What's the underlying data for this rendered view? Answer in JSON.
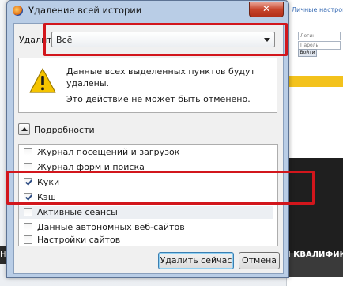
{
  "dialog": {
    "title": "Удаление всей истории",
    "close_glyph": "✕",
    "period_label": "Удалить:",
    "period_value": "Всё",
    "warning_line1": "Данные всех выделенных пунктов будут удалены.",
    "warning_line2": "Это действие не может быть отменено.",
    "details_label": "Подробности",
    "items": [
      {
        "label": "Журнал посещений и загрузок",
        "checked": false
      },
      {
        "label": "Журнал форм и поиска",
        "checked": false
      },
      {
        "label": "Куки",
        "checked": true
      },
      {
        "label": "Кэш",
        "checked": true
      },
      {
        "label": "Активные сеансы",
        "checked": false
      },
      {
        "label": "Данные автономных веб-сайтов",
        "checked": false
      },
      {
        "label": "Настройки сайтов",
        "checked": false
      }
    ],
    "clear_button": "Удалить сейчас",
    "cancel_button": "Отмена"
  },
  "background": {
    "right_link": "Личные настройки",
    "login_placeholder": "Логин",
    "password_placeholder": "Пароль",
    "enter_button": "Войти",
    "bottom_left_text": "НИ",
    "bottom_right_text": "Я КВАЛИФИК..."
  },
  "colors": {
    "annotation": "#d2161c",
    "title_bar": "#b9cde6",
    "close_button": "#c7452c"
  },
  "icons": {
    "app_icon": "firefox-icon",
    "warning_icon": "warning-triangle-icon"
  }
}
